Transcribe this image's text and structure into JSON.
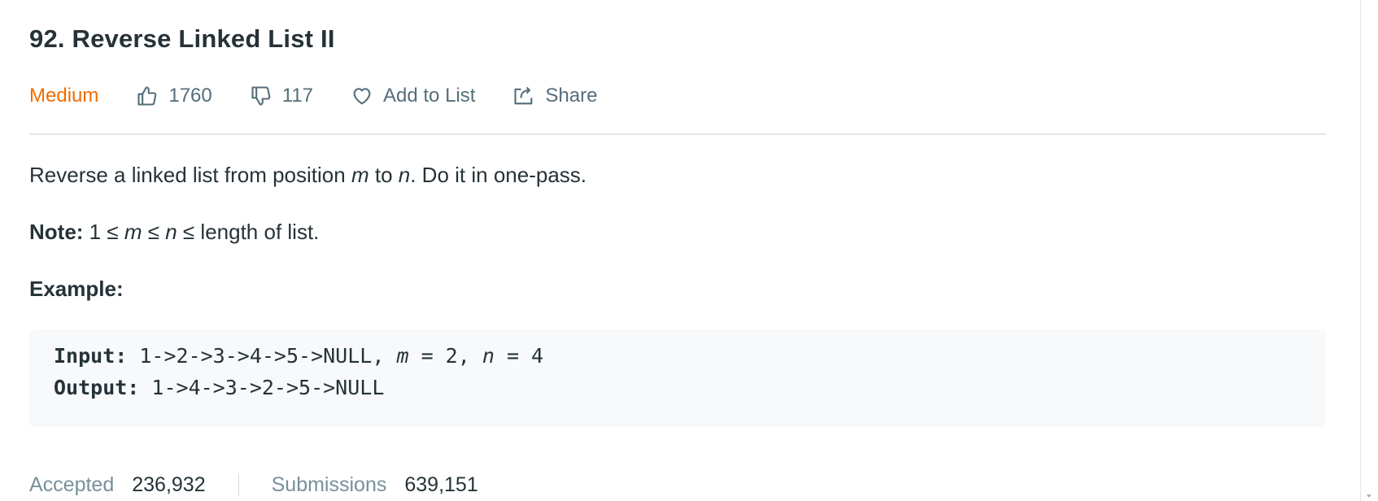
{
  "problem": {
    "title": "92. Reverse Linked List II",
    "difficulty": "Medium",
    "likes": "1760",
    "dislikes": "117",
    "add_to_list_label": "Add to List",
    "share_label": "Share"
  },
  "description": {
    "line_prefix": "Reverse a linked list from position ",
    "var_m": "m",
    "to_word": " to ",
    "var_n": "n",
    "line_suffix": ". Do it in one-pass.",
    "note_label": "Note:",
    "note_start": " 1 ≤ ",
    "note_m": "m",
    "note_mid": " ≤ ",
    "note_n": "n",
    "note_end": " ≤ length of list.",
    "example_label": "Example:"
  },
  "example": {
    "input_label": "Input:",
    "input_value": " 1->2->3->4->5->NULL, ",
    "input_m": "m",
    "input_m_value": " = 2, ",
    "input_n": "n",
    "input_n_value": " = 4",
    "output_label": "Output:",
    "output_value": " 1->4->3->2->5->NULL"
  },
  "stats": {
    "accepted_label": "Accepted",
    "accepted_value": "236,932",
    "submissions_label": "Submissions",
    "submissions_value": "639,151"
  },
  "colors": {
    "difficulty_medium": "#ef6c00",
    "meta_text": "#546e7a",
    "code_bg": "#f7f9fa"
  },
  "icons": {
    "like": "thumbs-up-icon",
    "dislike": "thumbs-down-icon",
    "favorite": "heart-icon",
    "share": "share-icon"
  }
}
